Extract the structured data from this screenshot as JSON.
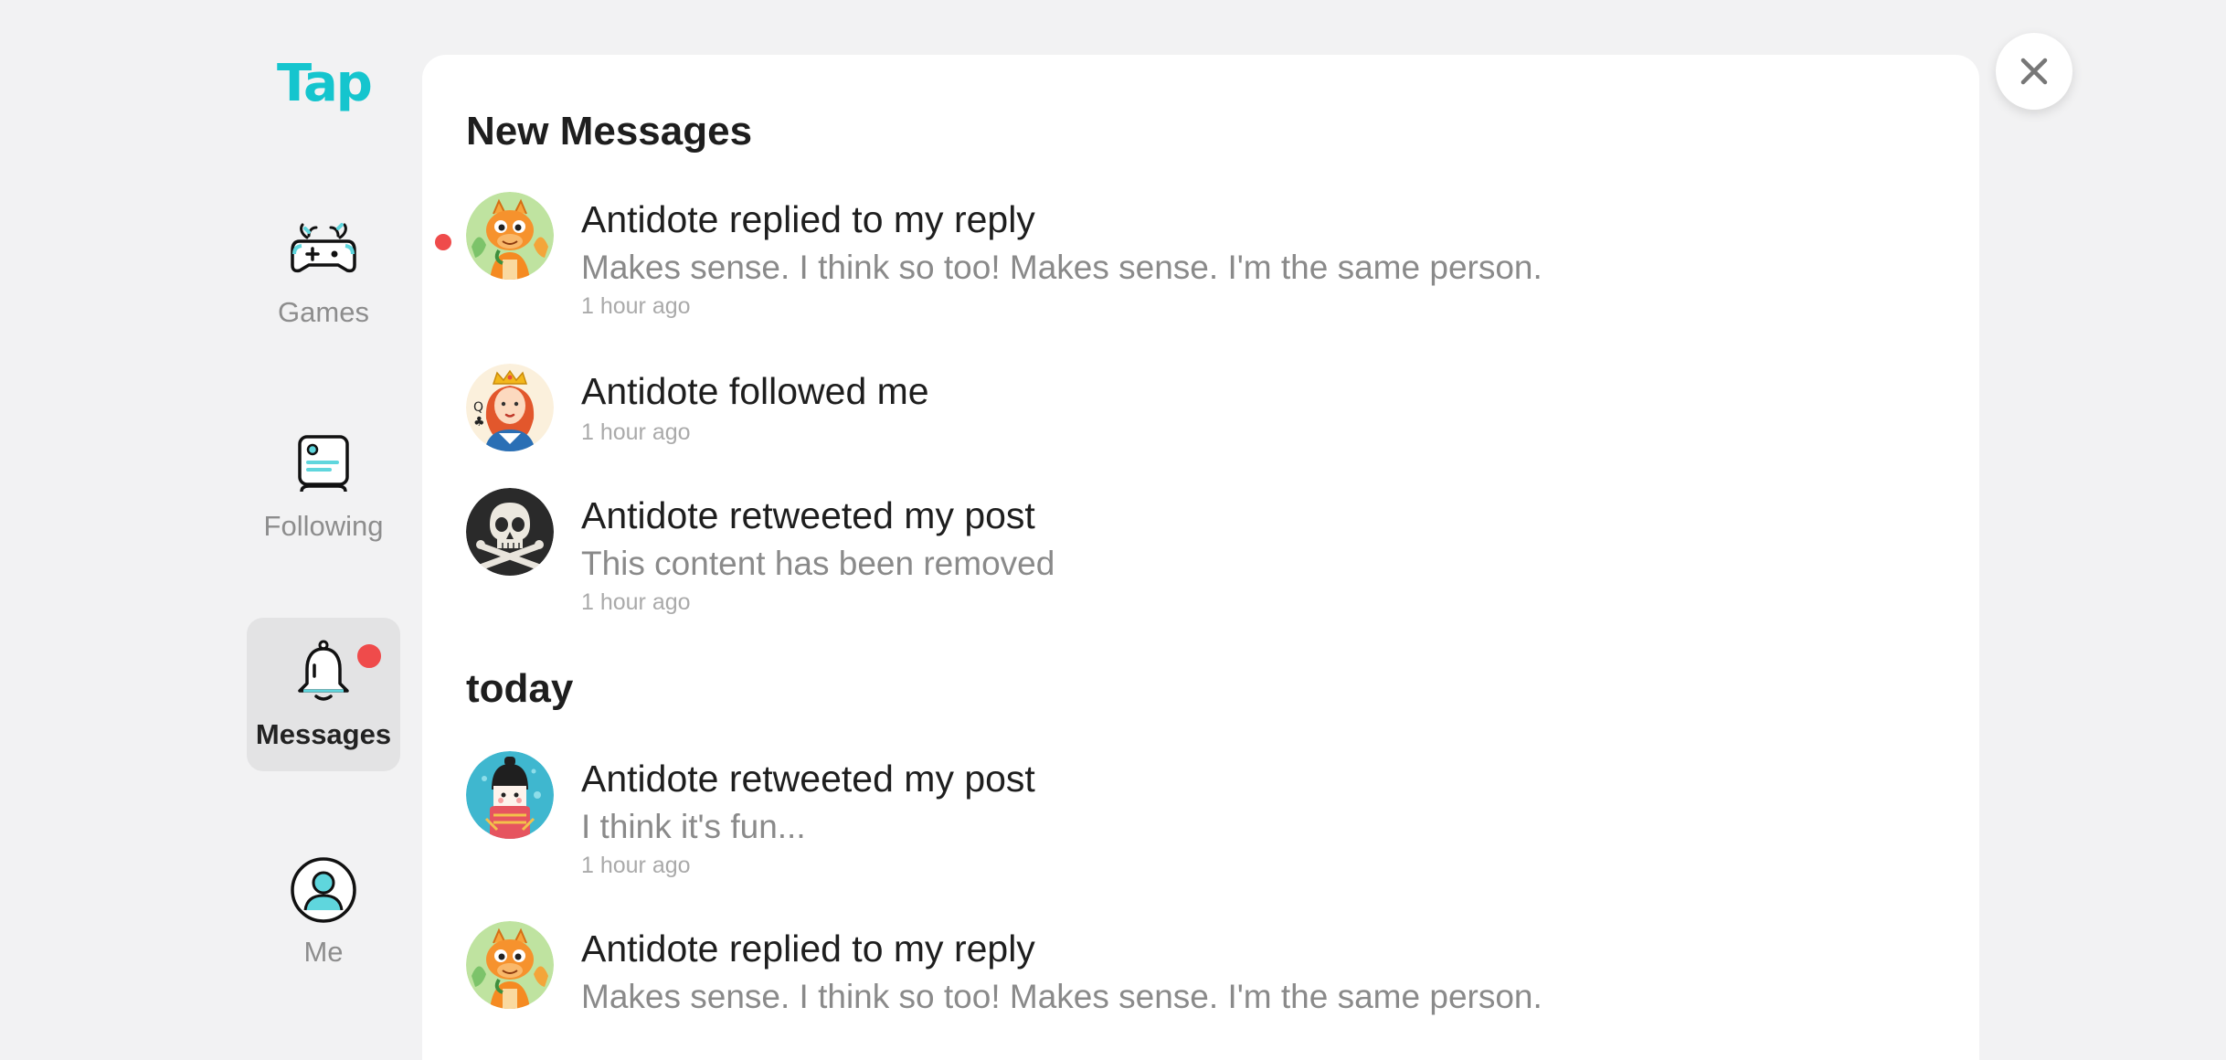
{
  "app": {
    "logo": "Tap",
    "brand_color": "#15c5ce",
    "alert_color": "#ef4b4b"
  },
  "sidebar": {
    "items": [
      {
        "label": "Games",
        "icon": "gamepad-icon",
        "active": false
      },
      {
        "label": "Following",
        "icon": "feed-card-icon",
        "active": false
      },
      {
        "label": "Messages",
        "icon": "bell-icon",
        "active": true,
        "badge": true
      },
      {
        "label": "Me",
        "icon": "person-icon",
        "active": false
      }
    ]
  },
  "close_button": {
    "icon": "close-icon"
  },
  "sections": [
    {
      "title": "New Messages",
      "messages": [
        {
          "avatar": "dragon-avatar",
          "unread": true,
          "title": "Antidote replied to my reply",
          "body": "Makes sense. I think so too! Makes sense. I'm the same person.",
          "time": "1 hour ago"
        },
        {
          "avatar": "queen-avatar",
          "unread": false,
          "title": "Antidote followed me",
          "body": "",
          "time": "1 hour ago"
        },
        {
          "avatar": "skull-avatar",
          "unread": false,
          "title": "Antidote retweeted my post",
          "body": "This content has been removed",
          "time": "1 hour ago"
        }
      ]
    },
    {
      "title": "today",
      "messages": [
        {
          "avatar": "kokeshi-avatar",
          "unread": false,
          "title": "Antidote retweeted my post",
          "body": "I think it's fun...",
          "time": "1 hour ago"
        },
        {
          "avatar": "dragon-avatar",
          "unread": false,
          "title": "Antidote replied to my reply",
          "body": "Makes sense. I think so too! Makes sense. I'm the same person.",
          "time": ""
        }
      ]
    }
  ]
}
